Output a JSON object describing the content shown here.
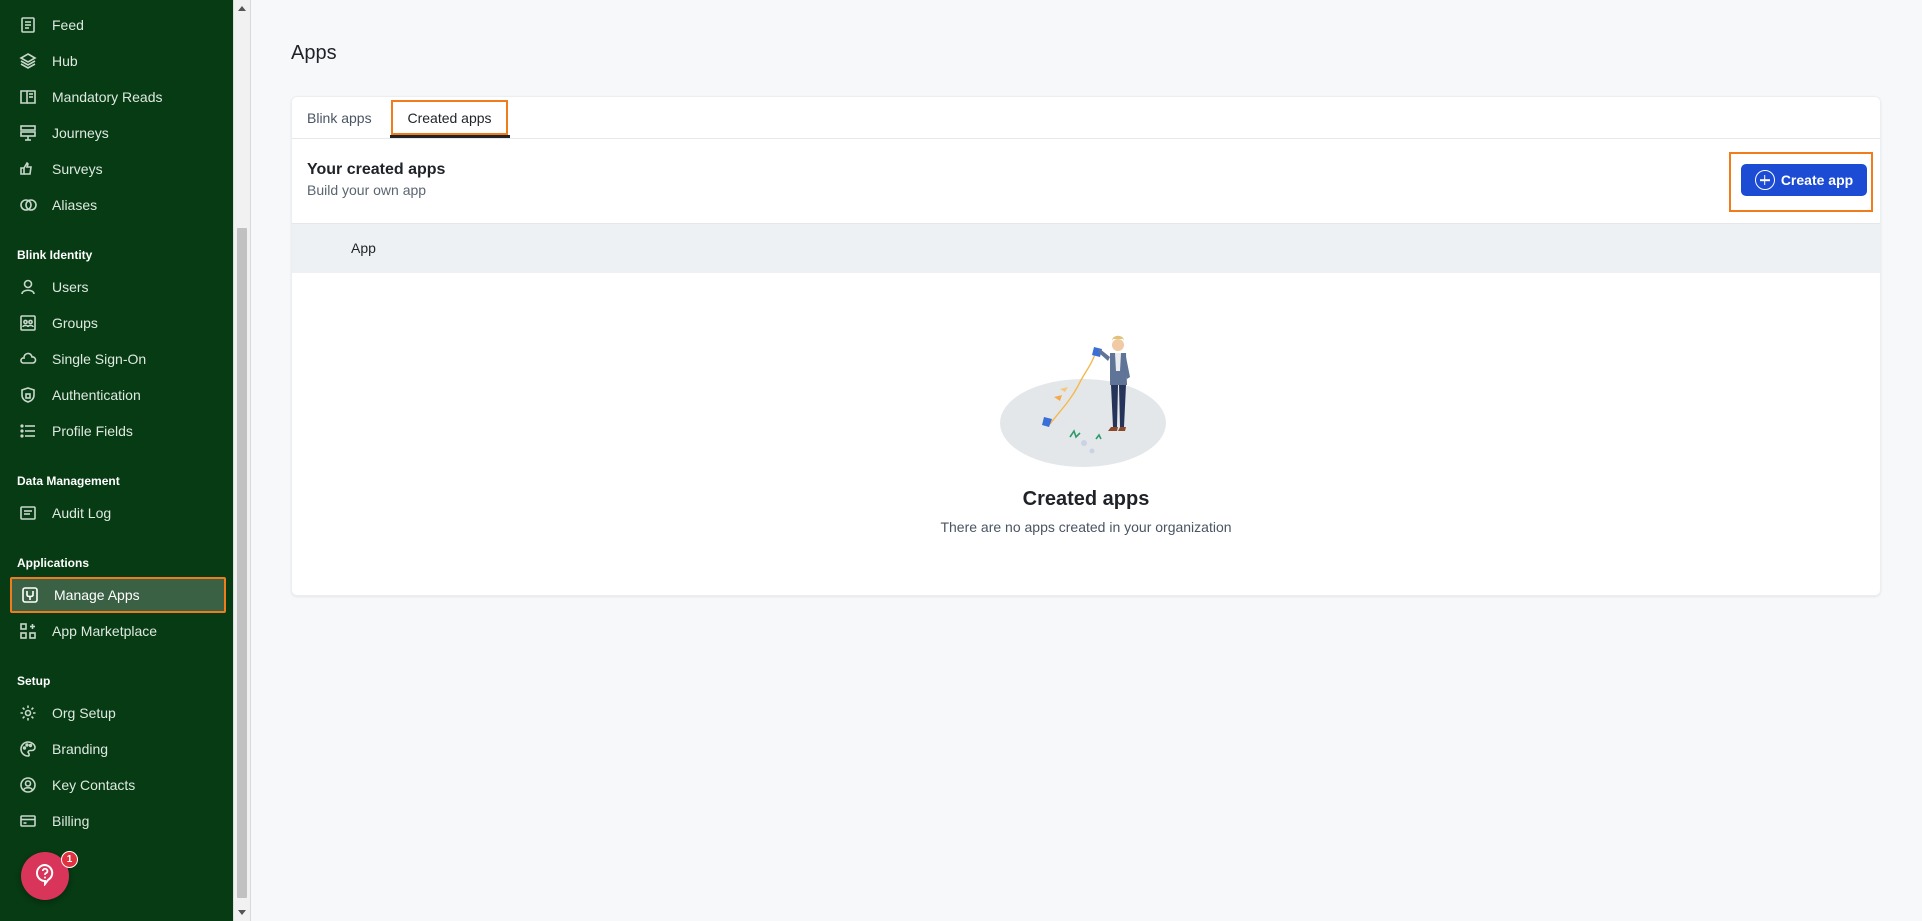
{
  "sidebar": {
    "items": [
      {
        "label": "Feed",
        "icon": "feed-icon"
      },
      {
        "label": "Hub",
        "icon": "layers-icon"
      },
      {
        "label": "Mandatory Reads",
        "icon": "book-icon"
      },
      {
        "label": "Journeys",
        "icon": "journey-icon"
      },
      {
        "label": "Surveys",
        "icon": "thumbs-icon"
      },
      {
        "label": "Aliases",
        "icon": "alias-icon"
      }
    ],
    "sections": [
      {
        "title": "Blink Identity",
        "items": [
          {
            "label": "Users",
            "icon": "user-icon"
          },
          {
            "label": "Groups",
            "icon": "groups-icon"
          },
          {
            "label": "Single Sign-On",
            "icon": "cloud-key-icon"
          },
          {
            "label": "Authentication",
            "icon": "shield-icon"
          },
          {
            "label": "Profile Fields",
            "icon": "list-icon"
          }
        ]
      },
      {
        "title": "Data Management",
        "items": [
          {
            "label": "Audit Log",
            "icon": "audit-icon"
          }
        ]
      },
      {
        "title": "Applications",
        "items": [
          {
            "label": "Manage Apps",
            "icon": "manage-apps-icon",
            "active": true
          },
          {
            "label": "App Marketplace",
            "icon": "marketplace-icon"
          }
        ]
      },
      {
        "title": "Setup",
        "items": [
          {
            "label": "Org Setup",
            "icon": "gear-icon"
          },
          {
            "label": "Branding",
            "icon": "palette-icon"
          },
          {
            "label": "Key Contacts",
            "icon": "contacts-icon"
          },
          {
            "label": "Billing",
            "icon": "card-icon"
          }
        ]
      }
    ],
    "help_badge": "1"
  },
  "main": {
    "title": "Apps",
    "tabs": [
      {
        "label": "Blink apps"
      },
      {
        "label": "Created apps",
        "active": true
      }
    ],
    "section_title": "Your created apps",
    "section_subtitle": "Build your own app",
    "create_button": "Create app",
    "table_header": "App",
    "empty_title": "Created apps",
    "empty_desc": "There are no apps created in your organization"
  },
  "colors": {
    "sidebar_bg": "#063b13",
    "accent_blue": "#1c4bd4",
    "highlight_orange": "#f07c1c"
  }
}
